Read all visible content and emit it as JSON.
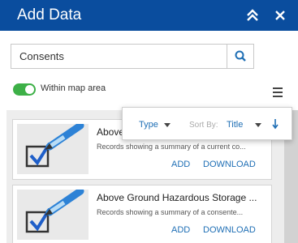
{
  "header": {
    "title": "Add Data",
    "collapse_icon": "double-chevron-up-icon",
    "close_icon": "close-icon",
    "bg_color": "#0a4d9e"
  },
  "search": {
    "value": "Consents",
    "icon": "search-icon"
  },
  "filter": {
    "toggle_label": "Within map area",
    "toggle_on": true,
    "toggle_color": "#3db047",
    "menu_icon": "hamburger-menu-icon"
  },
  "sort_popup": {
    "type_label": "Type",
    "sort_by_label": "Sort By:",
    "sort_field": "Title",
    "direction_icon": "sort-descending-arrow-icon"
  },
  "results": [
    {
      "title": "Above",
      "description": "Records showing a summary of a current co...",
      "add_label": "ADD",
      "download_label": "DOWNLOAD",
      "thumbnail_icon": "checklist-pen-icon"
    },
    {
      "title": "Above Ground Hazardous Storage ...",
      "description": "Records showing a summary of a consente...",
      "add_label": "ADD",
      "download_label": "DOWNLOAD",
      "thumbnail_icon": "checklist-pen-icon"
    }
  ],
  "link_color": "#1f6fb5"
}
